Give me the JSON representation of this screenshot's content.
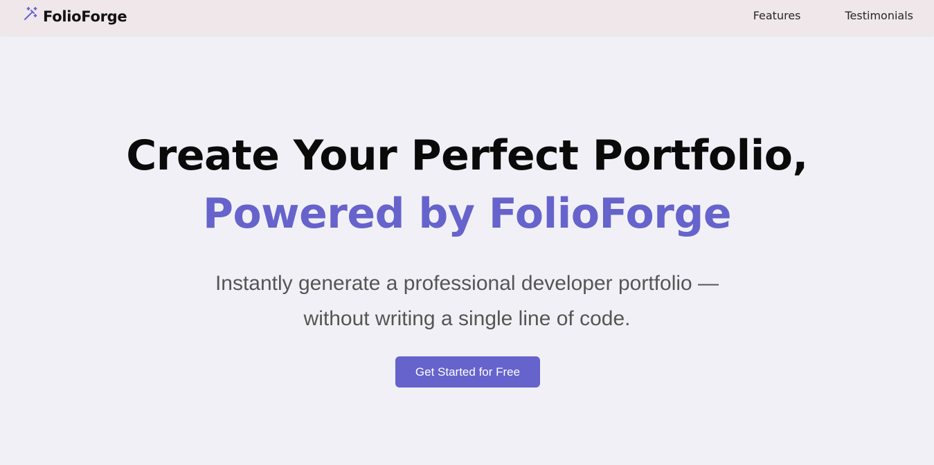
{
  "header": {
    "brand_name": "FolioForge",
    "brand_icon": "magic-wand-icon",
    "nav": [
      {
        "label": "Features"
      },
      {
        "label": "Testimonials"
      }
    ]
  },
  "hero": {
    "title_line1": "Create Your Perfect Portfolio,",
    "title_line2": "Powered by FolioForge",
    "subtitle_line1": "Instantly generate a professional developer portfolio —",
    "subtitle_line2": "without writing a single line of code.",
    "cta_label": "Get Started for Free"
  },
  "colors": {
    "accent": "#6663cc",
    "navbar_bg": "#efe7ea",
    "page_bg": "#f1f0f6",
    "title_text": "#0a0a0a",
    "subtitle_text": "#555555"
  }
}
